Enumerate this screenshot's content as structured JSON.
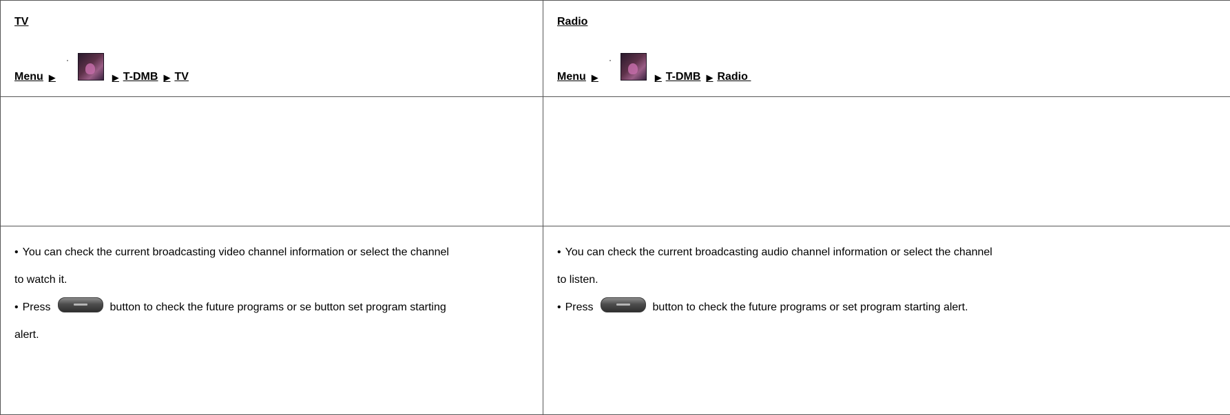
{
  "tv": {
    "title": "TV",
    "menu_label": "Menu",
    "arrow": "▶",
    "tdmb_label": "T-DMB",
    "target_label": "TV",
    "line1": "You can check the current broadcasting video channel information or select the channel",
    "line1_cont": "to watch it.",
    "press_label": "Press",
    "line2_rest": "button to check the future programs or se button set program starting",
    "line2_cont": "alert."
  },
  "radio": {
    "title": "Radio",
    "menu_label": "Menu",
    "arrow": "▶",
    "tdmb_label": "T-DMB",
    "target_label": "Radio",
    "line1": "You can check the current broadcasting audio channel information or select the channel",
    "line1_cont": "to listen.",
    "press_label": "Press",
    "line2_rest": "button to check the future programs or set program starting alert."
  },
  "bullet": "•",
  "icons": {
    "menu_icon": "tdmb-app-icon",
    "program_button_icon": "epg-button-icon"
  }
}
